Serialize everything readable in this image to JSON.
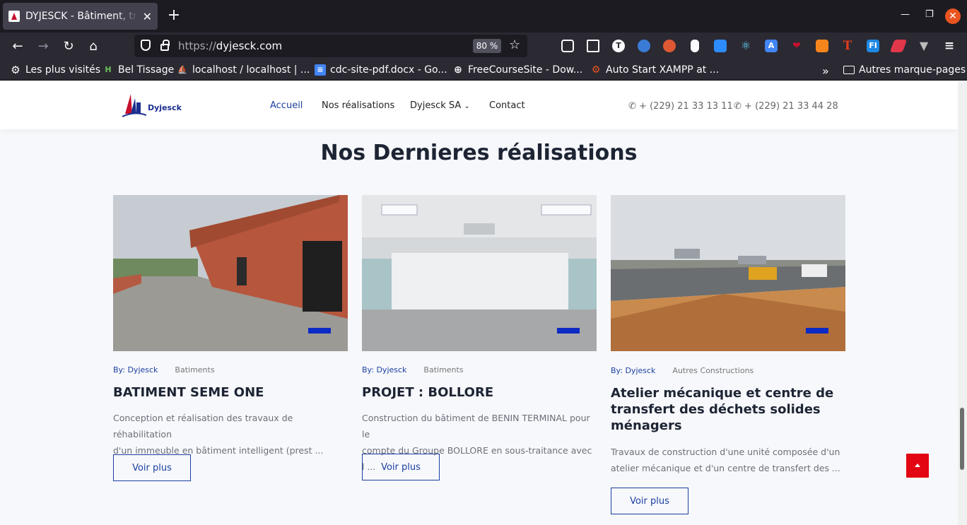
{
  "browser": {
    "tab_title": "DYJESCK - Bâtiment, travaux publics",
    "url_protocol": "https://",
    "url_host": "dyjesck.com",
    "zoom": "80 %",
    "bookmarks": [
      "Les plus visités",
      "Bel Tissage",
      "localhost / localhost | ...",
      "cdc-site-pdf.docx - Go...",
      "FreeCourseSite - Dow...",
      "Auto Start XAMPP at ..."
    ],
    "other_bookmarks": "Autres marque-pages"
  },
  "site": {
    "logo_text": "Dyjesck",
    "menu": [
      "Accueil",
      "Nos réalisations",
      "Dyjesck SA",
      "Contact"
    ],
    "phones": [
      "+ (229) 21 33 13 11",
      "+ (229) 21 33 44 28"
    ]
  },
  "section": {
    "title": "Nos Dernieres réalisations"
  },
  "cards": [
    {
      "by": "By: Dyjesck",
      "category": "Batiments",
      "title": "BATIMENT SEME ONE",
      "desc_line1": "Conception et réalisation des travaux de réhabilitation",
      "desc_line2": "d'un immeuble en bâtiment intelligent (prest ...",
      "button": "Voir plus"
    },
    {
      "by": "By: Dyjesck",
      "category": "Batiments",
      "title": "PROJET : BOLLORE",
      "desc_line1": "Construction du bâtiment de BENIN TERMINAL pour le",
      "desc_line2": "compte du Groupe BOLLORE en sous-traitance avec l ...",
      "button": "Voir plus"
    },
    {
      "by": "By: Dyjesck",
      "category": "Autres Constructions",
      "title_line1": "Atelier mécanique et centre de",
      "title_line2": "transfert des déchets solides",
      "title_line3": "ménagers",
      "desc_line1": "Travaux de construction d'une unité composée d'un",
      "desc_line2": "atelier mécanique et d'un centre de transfert des ...",
      "button": "Voir plus"
    }
  ],
  "colors": {
    "brand_blue": "#1b3fa0",
    "accent_red": "#e30613",
    "image_tag": "#0c2ac4"
  }
}
